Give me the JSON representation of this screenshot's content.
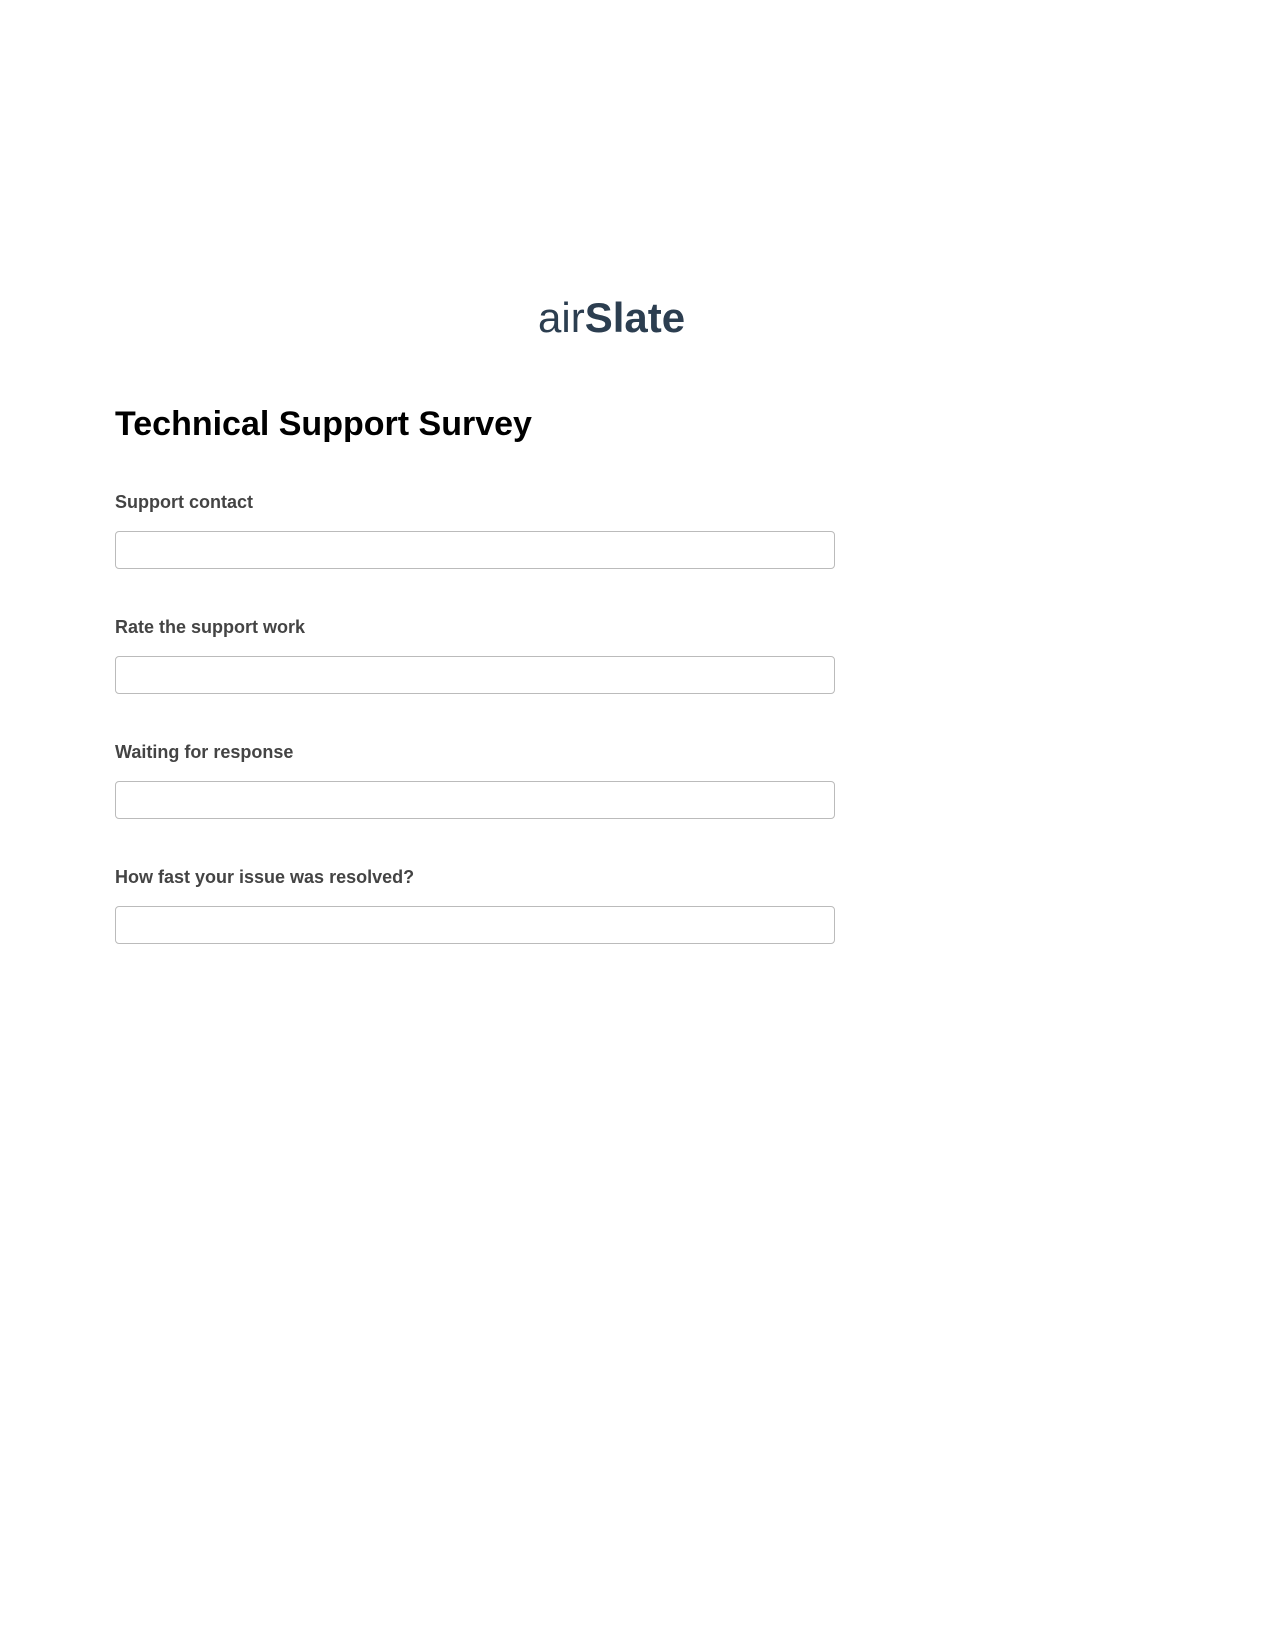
{
  "logo": {
    "prefix": "air",
    "suffix": "Slate"
  },
  "title": "Technical Support Survey",
  "fields": [
    {
      "label": "Support contact",
      "value": ""
    },
    {
      "label": "Rate the support work",
      "value": ""
    },
    {
      "label": "Waiting for response",
      "value": ""
    },
    {
      "label": "How fast your issue was resolved?",
      "value": ""
    }
  ]
}
